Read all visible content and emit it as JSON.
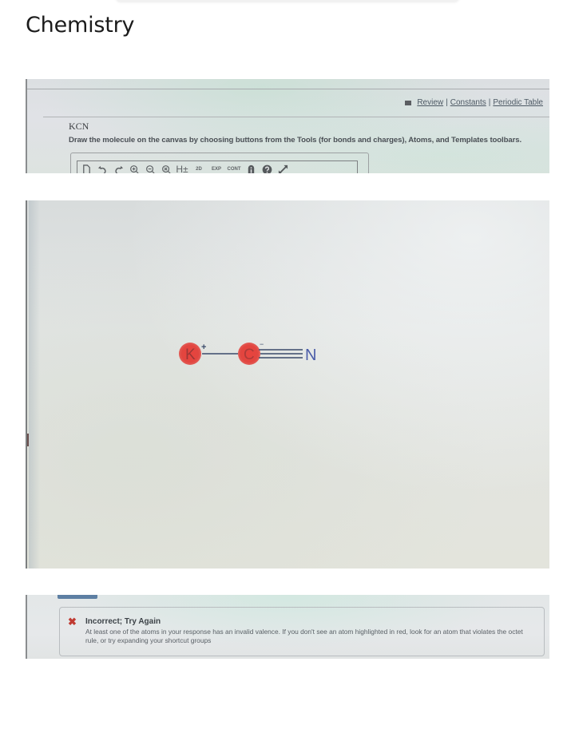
{
  "page": {
    "title": "Chemistry"
  },
  "question": {
    "links": [
      {
        "label": "Review"
      },
      {
        "label": "Constants"
      },
      {
        "label": "Periodic Table"
      }
    ],
    "link_separator": "|",
    "title": "KCN",
    "instructions": "Draw the molecule on the canvas by choosing buttons from the Tools (for bonds and charges), Atoms, and Templates toolbars."
  },
  "toolbar": {
    "items": [
      {
        "icon": "new-document-icon"
      },
      {
        "icon": "undo-icon"
      },
      {
        "icon": "redo-icon"
      },
      {
        "icon": "zoom-in-icon"
      },
      {
        "icon": "zoom-out-icon"
      },
      {
        "icon": "zoom-reset-icon"
      },
      {
        "icon": "hydrogens-icon",
        "label": "H±"
      },
      {
        "icon": "2d-clean-icon",
        "label": "2D"
      },
      {
        "icon": "expand-icon",
        "label": "EXP"
      },
      {
        "icon": "contract-icon",
        "label": "CONT"
      },
      {
        "icon": "info-icon"
      },
      {
        "icon": "help-icon"
      },
      {
        "icon": "fullscreen-icon"
      }
    ]
  },
  "molecule": {
    "atoms": [
      {
        "symbol": "K",
        "charge": "+",
        "highlighted": true
      },
      {
        "symbol": "C",
        "charge": "−",
        "highlighted": true
      },
      {
        "symbol": "N",
        "charge": "",
        "highlighted": false
      }
    ],
    "bonds": [
      {
        "from": "K",
        "to": "C",
        "order": 1
      },
      {
        "from": "C",
        "to": "N",
        "order": 3
      }
    ],
    "colors": {
      "highlight": "#e2453f",
      "bond": "#3a4a6a",
      "nitrogen": "#4a5ca8"
    }
  },
  "feedback": {
    "status": "incorrect",
    "icon": "x-icon",
    "title": "Incorrect; Try Again",
    "message": "At least one of the atoms in your response has an invalid valence. If you don't see an atom highlighted in red, look for an atom that violates the octet rule, or try expanding your shortcut groups",
    "colors": {
      "x": "#c03a32"
    }
  }
}
